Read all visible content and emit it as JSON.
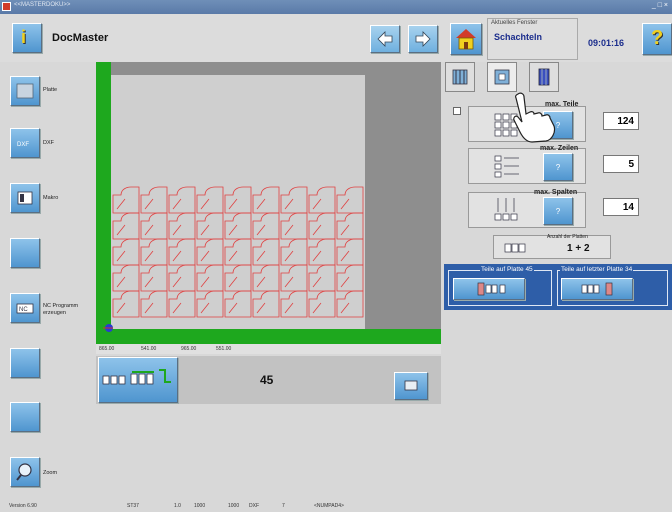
{
  "titlebar": {
    "title": "<<MASTERDOKU>>",
    "controls": "_ □ ×"
  },
  "header": {
    "app_title": "DocMaster",
    "info_icon": "info-icon",
    "back_icon": "arrow-left-icon",
    "forward_icon": "arrow-right-icon",
    "home_icon": "home-icon",
    "help_icon": "question-icon",
    "active_window_label": "Aktuelles Fenster",
    "active_window_value": "Schachteln",
    "clock": "09:01:16"
  },
  "sidebar": {
    "items": [
      {
        "label": "Platte",
        "icon": "plate-icon"
      },
      {
        "label": "DXF",
        "icon": "dxf-icon"
      },
      {
        "label": "Makro",
        "icon": "macro-icon"
      },
      {
        "label": "",
        "icon": ""
      },
      {
        "label": "NC Programm erzeugen",
        "icon": "nc-program-icon"
      },
      {
        "label": "",
        "icon": ""
      },
      {
        "label": "",
        "icon": ""
      },
      {
        "label": "Zoom",
        "icon": "zoom-icon"
      }
    ]
  },
  "canvas": {
    "coords": [
      "865.00",
      "541.00",
      "965.00",
      "551.00"
    ],
    "grid_rows": 5,
    "grid_cols": 9
  },
  "bottom": {
    "count": "45"
  },
  "right": {
    "tabs": [
      "nest-list-tab",
      "nest-parts-tab",
      "nest-settings-tab"
    ],
    "options": [
      {
        "label": "max. Teile",
        "value": "124",
        "q": "?"
      },
      {
        "label": "max. Zeilen",
        "value": "5",
        "q": "?"
      },
      {
        "label": "max. Spalten",
        "value": "14",
        "q": "?"
      }
    ],
    "plates_label": "Anzahl der Platten",
    "plates_value": "1 + 2",
    "group_left_label": "Teile auf Platte 45",
    "group_right_label": "Teile auf letzter Platte 34"
  },
  "status": {
    "version": "Version 6.90",
    "material": "ST37",
    "thickness": "1.0",
    "dim_x": "1000",
    "dim_y": "1000",
    "format": "DXF",
    "n": "7",
    "numpad": "<NUMPAD4>"
  },
  "colors": {
    "accent": "#4f95cf",
    "plate_green": "#1ea81e",
    "parts": "#e04040"
  }
}
